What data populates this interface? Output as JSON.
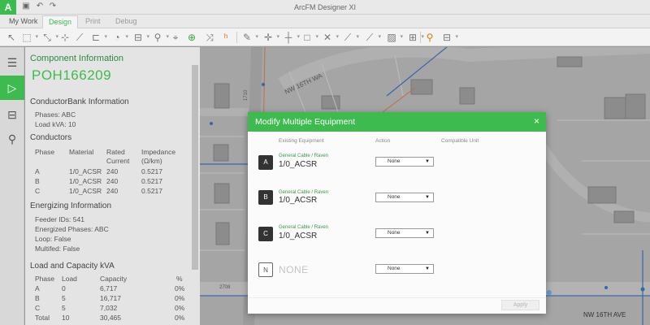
{
  "app": {
    "title": "ArcFM Designer XI",
    "logo": "A"
  },
  "titlebar": {
    "icons": [
      "save-icon",
      "undo-icon",
      "redo-icon"
    ]
  },
  "tabs": [
    {
      "label": "My Work"
    },
    {
      "label": "Design"
    },
    {
      "label": "Print"
    },
    {
      "label": "Debug"
    }
  ],
  "rail": {
    "items": [
      "list-icon",
      "play-icon",
      "map-icon",
      "search-map-icon"
    ]
  },
  "panel": {
    "title": "Component Information",
    "id": "POH166209",
    "conductor_bank": {
      "heading": "ConductorBank Information",
      "phases": "Phases: ABC",
      "load": "Load kVA: 10"
    },
    "conductors": {
      "heading": "Conductors",
      "headers": [
        "Phase",
        "Material",
        "Rated",
        "Impedance"
      ],
      "headers2": [
        "",
        "",
        "Current",
        "(Ω/km)"
      ],
      "rows": [
        [
          "A",
          "1/0_ACSR",
          "240",
          "0.5217"
        ],
        [
          "B",
          "1/0_ACSR",
          "240",
          "0.5217"
        ],
        [
          "C",
          "1/0_ACSR",
          "240",
          "0.5217"
        ]
      ]
    },
    "energizing": {
      "heading": "Energizing Information",
      "feeder": "Feeder IDs: 541",
      "phases": "Energized Phases: ABC",
      "loop": "Loop: False",
      "multifed": "Multifed: False"
    },
    "load": {
      "heading": "Load and Capacity kVA",
      "headers": [
        "Phase",
        "Load",
        "Capacity",
        "%"
      ],
      "rows": [
        [
          "A",
          "0",
          "6,717",
          "0%"
        ],
        [
          "B",
          "5",
          "16,717",
          "0%"
        ],
        [
          "C",
          "5",
          "7,032",
          "0%"
        ],
        [
          "Total",
          "10",
          "30,465",
          "0%"
        ]
      ]
    }
  },
  "map": {
    "labels": {
      "street1": "NW 16TH WA",
      "street2": "NW 16TH AVE",
      "num1": "2708",
      "num2": "1710"
    }
  },
  "modal": {
    "title": "Modify Multiple Equipment",
    "close": "×",
    "col_existing": "Existing Equipment",
    "col_action": "Action",
    "col_compatible": "Compatible Unit",
    "rows": [
      {
        "phase": "A",
        "sub": "General Cable / Raven",
        "name": "1/0_ACSR",
        "action": "None"
      },
      {
        "phase": "B",
        "sub": "General Cable / Raven",
        "name": "1/0_ACSR",
        "action": "None"
      },
      {
        "phase": "C",
        "sub": "General Cable / Raven",
        "name": "1/0_ACSR",
        "action": "None"
      },
      {
        "phase": "N",
        "sub": "",
        "name": "NONE",
        "action": "None"
      }
    ],
    "apply": "Apply"
  },
  "colors": {
    "accent": "#3dbb4e",
    "map_bg": "#a3a3a3"
  }
}
